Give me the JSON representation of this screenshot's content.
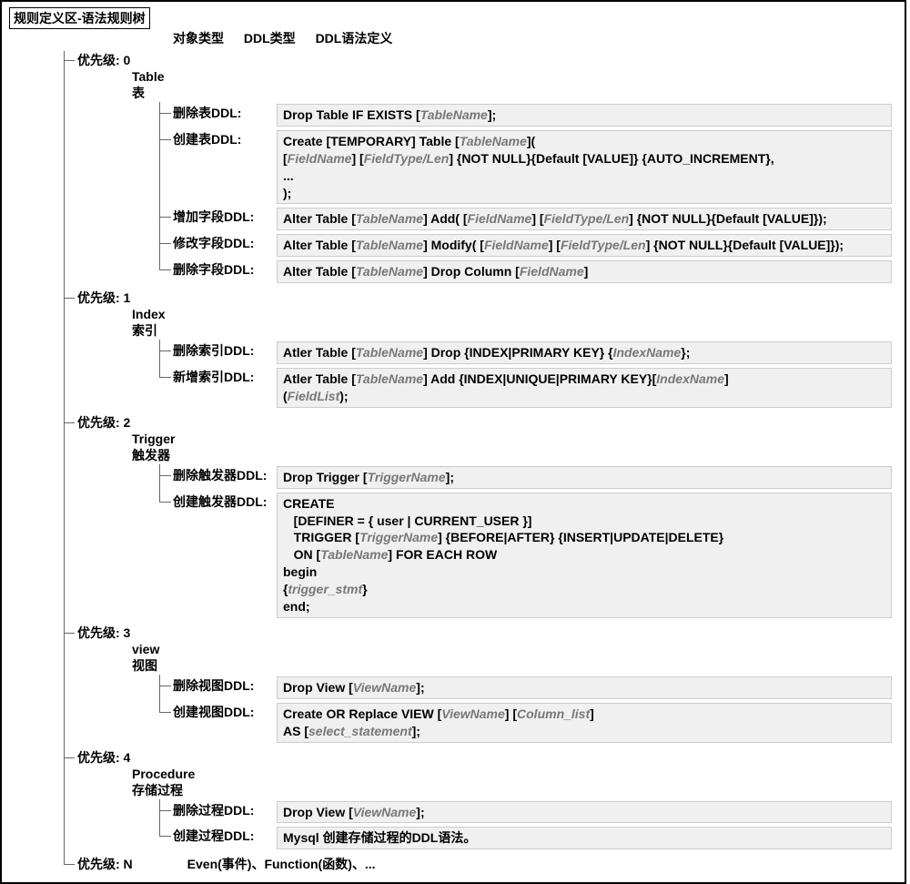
{
  "root_title": "规则定义区-语法规则树",
  "col_headers": {
    "obj": "对象类型",
    "ddl": "DDL类型",
    "syntax": "DDL语法定义"
  },
  "priorities": [
    {
      "label": "优先级: 0",
      "obj_en": "Table",
      "obj_cn": "表",
      "rules": [
        {
          "label": "删除表DDL:",
          "body_html": "Drop Table IF EXISTS [<span class='ph'>TableName</span>];"
        },
        {
          "label": "创建表DDL:",
          "body_html": "Create [TEMPORARY] Table [<span class='ph'>TableName</span>](\n[<span class='ph'>FieldName</span>] [<span class='ph'>FieldType/Len</span>] {NOT NULL}{Default [VALUE]} {AUTO_INCREMENT},\n...\n);"
        },
        {
          "label": "增加字段DDL:",
          "body_html": "Alter Table [<span class='ph'>TableName</span>] Add( [<span class='ph'>FieldName</span>] [<span class='ph'>FieldType/Len</span>] {NOT NULL}{Default [VALUE]});"
        },
        {
          "label": "修改字段DDL:",
          "body_html": "Alter Table [<span class='ph'>TableName</span>] Modify( [<span class='ph'>FieldName</span>] [<span class='ph'>FieldType/Len</span>] {NOT NULL}{Default [VALUE]});"
        },
        {
          "label": "删除字段DDL:",
          "body_html": "Alter Table [<span class='ph'>TableName</span>] Drop Column [<span class='ph'>FieldName</span>]"
        }
      ]
    },
    {
      "label": "优先级: 1",
      "obj_en": "Index",
      "obj_cn": "索引",
      "rules": [
        {
          "label": "删除索引DDL:",
          "body_html": "Atler Table [<span class='ph'>TableName</span>] Drop {INDEX|PRIMARY KEY} {<span class='ph'>IndexName</span>};"
        },
        {
          "label": "新增索引DDL:",
          "body_html": "Atler Table [<span class='ph'>TableName</span>] Add {INDEX|UNIQUE|PRIMARY KEY}[<span class='ph'>IndexName</span>]\n(<span class='ph'>FieldList</span>);"
        }
      ]
    },
    {
      "label": "优先级: 2",
      "obj_en": "Trigger",
      "obj_cn": "触发器",
      "rules": [
        {
          "label": "删除触发器DDL:",
          "body_html": "Drop Trigger [<span class='ph'>TriggerName</span>];"
        },
        {
          "label": "创建触发器DDL:",
          "body_html": "CREATE\n   [DEFINER = { user | CURRENT_USER }]\n   TRIGGER [<span class='ph'>TriggerName</span>] {BEFORE|AFTER} {INSERT|UPDATE|DELETE}\n   ON [<span class='ph'>TableName</span>] FOR EACH ROW\nbegin\n{<span class='ph'>trigger_stmt</span>}\nend;"
        }
      ]
    },
    {
      "label": "优先级: 3",
      "obj_en": "view",
      "obj_cn": "视图",
      "rules": [
        {
          "label": "删除视图DDL:",
          "body_html": "Drop View [<span class='ph'>ViewName</span>];"
        },
        {
          "label": "创建视图DDL:",
          "body_html": "Create OR Replace VIEW [<span class='ph'>ViewName</span>] [<span class='ph'>Column_list</span>]\nAS [<span class='ph'>select_statement</span>];"
        }
      ]
    },
    {
      "label": "优先级: 4",
      "obj_en": "Procedure",
      "obj_cn": "存储过程",
      "rules": [
        {
          "label": "删除过程DDL:",
          "body_html": "Drop View [<span class='ph'>ViewName</span>];"
        },
        {
          "label": "创建过程DDL:",
          "body_html": "Mysql 创建存储过程的DDL语法。"
        }
      ]
    },
    {
      "label": "优先级: N",
      "n_extra": "Even(事件)、Function(函数)、...",
      "rules": []
    }
  ]
}
